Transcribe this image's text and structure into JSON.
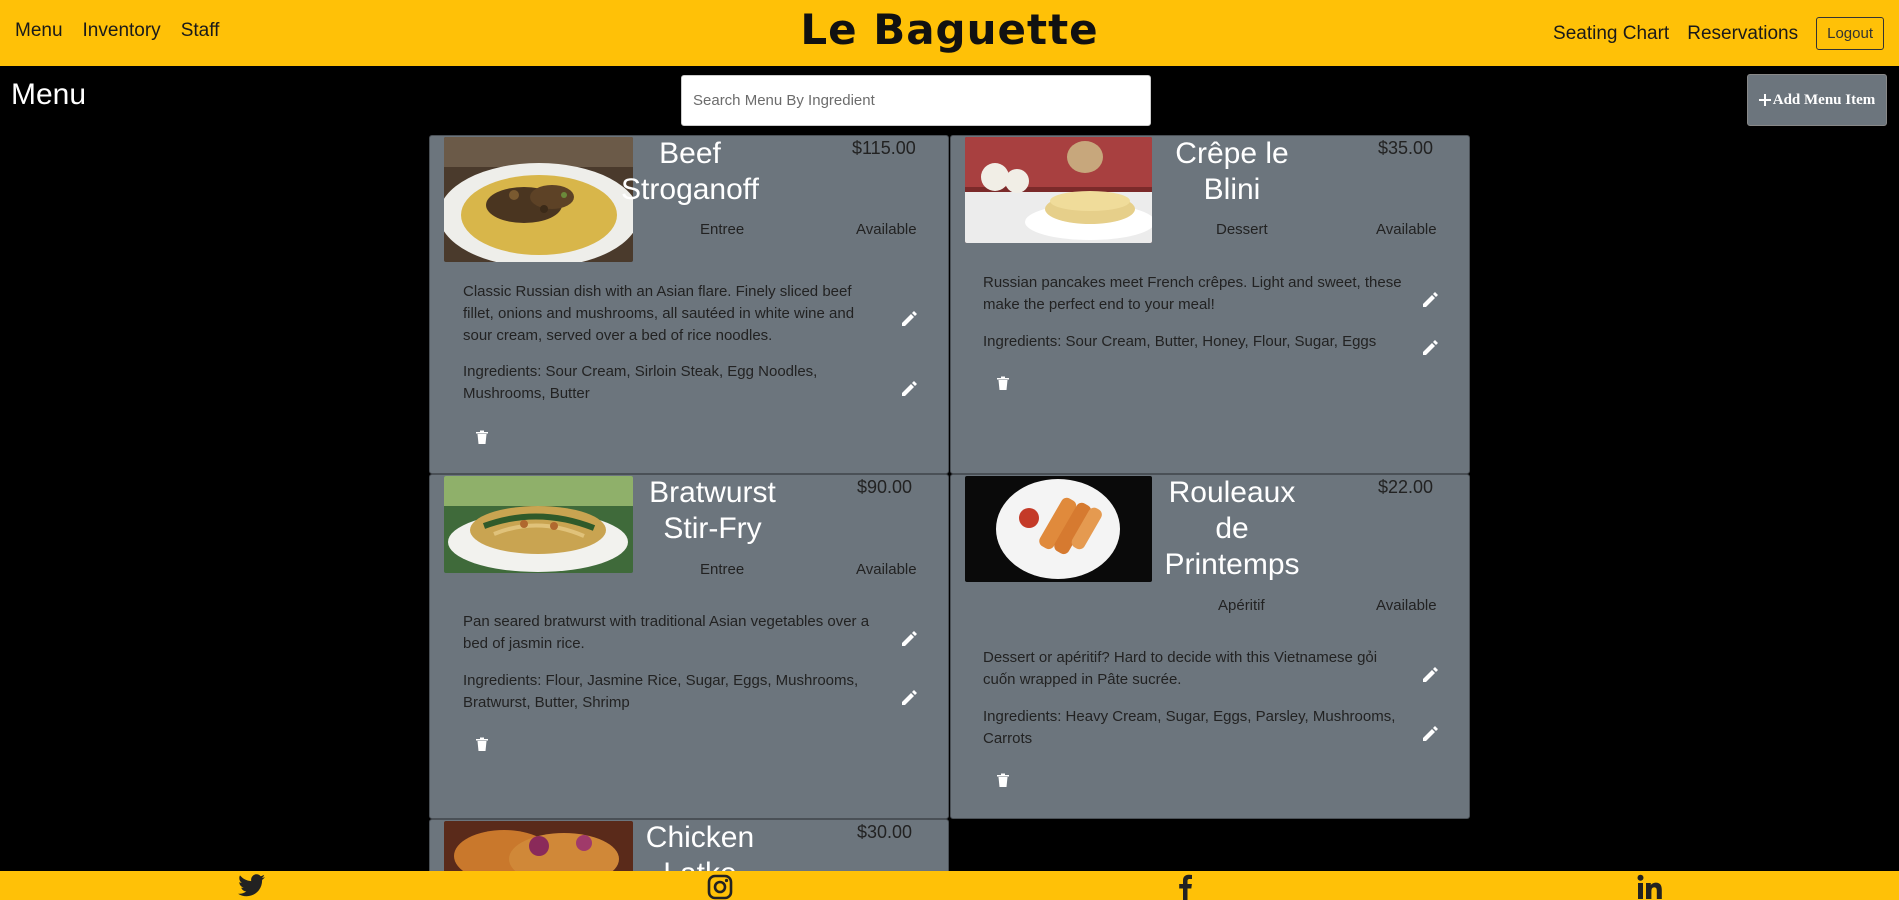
{
  "nav": {
    "left": [
      "Menu",
      "Inventory",
      "Staff"
    ],
    "brand": "Le Baguette",
    "right": [
      "Seating Chart",
      "Reservations"
    ],
    "logout": "Logout"
  },
  "page": {
    "title": "Menu",
    "search_placeholder": "Search Menu By Ingredient",
    "add_button": "Add Menu Item"
  },
  "items": [
    {
      "name_lines": [
        "Beef",
        "Stroganoff"
      ],
      "price": "$115.00",
      "category": "Entree",
      "availability": "Available",
      "description_lines": [
        "Classic Russian dish with an Asian flare. Finely sliced beef",
        "fillet, onions and mushrooms, all sautéed in white wine and",
        "sour cream, served over a bed of rice noodles."
      ],
      "ingredient_lines": [
        "Ingredients: Sour Cream, Sirloin Steak, Egg Noodles,",
        "Mushrooms, Butter"
      ],
      "image": "beef-stroganoff-photo"
    },
    {
      "name_lines": [
        "Crêpe le",
        "Blini"
      ],
      "price": "$35.00",
      "category": "Dessert",
      "availability": "Available",
      "description_lines": [
        "Russian pancakes meet French crêpes. Light and sweet, these",
        "make the perfect end to your meal!"
      ],
      "ingredient_lines": [
        "Ingredients: Sour Cream, Butter, Honey, Flour, Sugar, Eggs"
      ],
      "image": "crepe-photo"
    },
    {
      "name_lines": [
        "Bratwurst",
        "Stir-Fry"
      ],
      "price": "$90.00",
      "category": "Entree",
      "availability": "Available",
      "description_lines": [
        "Pan seared bratwurst with traditional Asian vegetables over a",
        "bed of jasmin rice."
      ],
      "ingredient_lines": [
        "Ingredients: Flour, Jasmine Rice, Sugar, Eggs, Mushrooms,",
        "Bratwurst, Butter, Shrimp"
      ],
      "image": "stir-fry-photo"
    },
    {
      "name_lines": [
        "Rouleaux",
        "de",
        "Printemps"
      ],
      "price": "$22.00",
      "category": "Apéritif",
      "availability": "Available",
      "description_lines": [
        "Dessert or apéritif? Hard to decide with this Vietnamese gỏi",
        "cuốn wrapped in Pâte sucrée."
      ],
      "ingredient_lines": [
        "Ingredients: Heavy Cream, Sugar, Eggs, Parsley, Mushrooms,",
        "Carrots"
      ],
      "image": "spring-rolls-photo"
    },
    {
      "name_lines": [
        "Chicken",
        "Latke"
      ],
      "price": "$30.00",
      "image": "latke-photo"
    }
  ],
  "footer": {
    "icons": [
      "twitter-icon",
      "instagram-icon",
      "facebook-icon",
      "linkedin-icon"
    ]
  },
  "colors": {
    "accent": "#ffc107",
    "card": "#6c757d",
    "background": "#000000"
  }
}
